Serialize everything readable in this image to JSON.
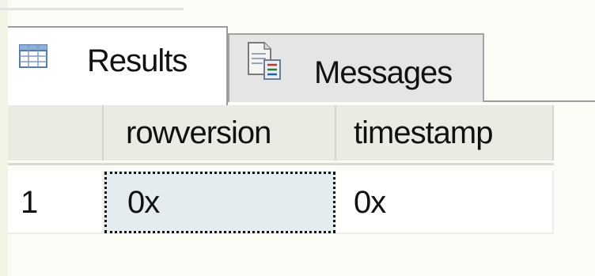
{
  "tabs": [
    {
      "label": "Results",
      "icon": "grid-icon",
      "active": true
    },
    {
      "label": "Messages",
      "icon": "messages-doc-icon",
      "active": false
    }
  ],
  "grid": {
    "columns": [
      "",
      "rowversion",
      "timestamp"
    ],
    "rows": [
      {
        "row_number": "1",
        "rowversion": "0x",
        "timestamp": "0x"
      }
    ],
    "selected_cell": "rowversion"
  },
  "colors": {
    "header_bg": "#ebebe4",
    "selected_cell_bg": "#e5ecef",
    "inactive_tab_bg": "#e5e5e5",
    "page_bg": "#fbfcf5"
  }
}
